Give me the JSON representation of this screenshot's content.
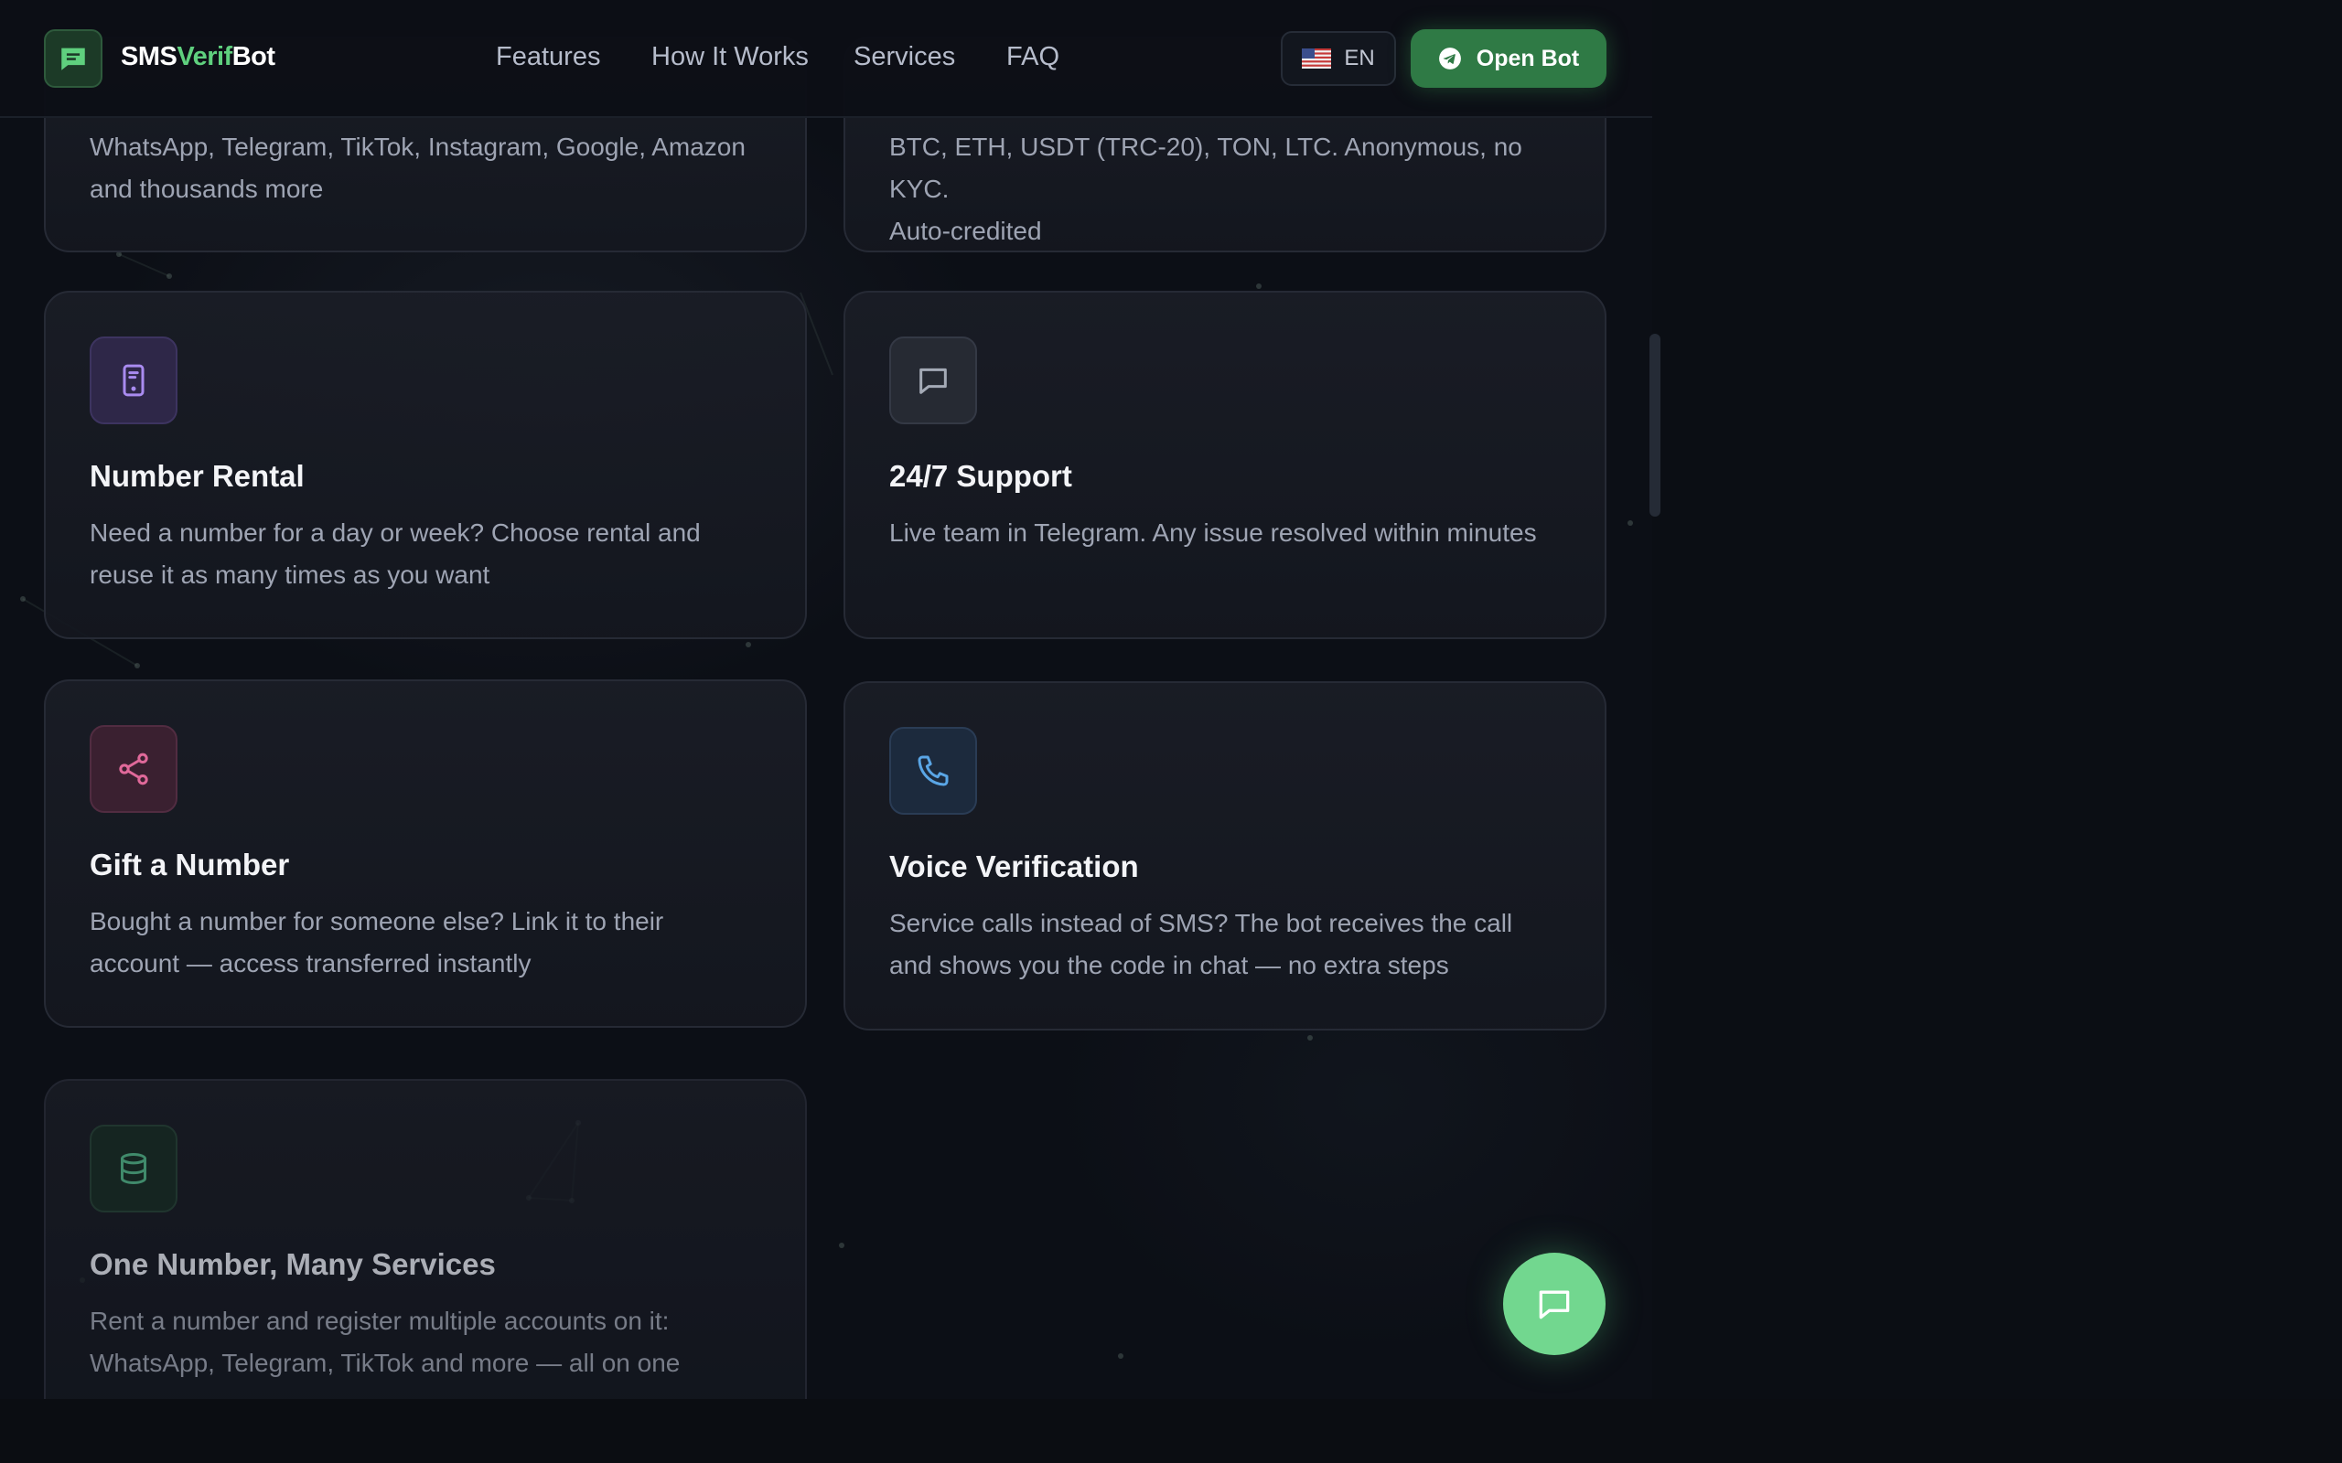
{
  "header": {
    "brand_prefix": "SMS",
    "brand_accent": "Verif",
    "brand_suffix": "Bot",
    "nav": [
      "Features",
      "How It Works",
      "Services",
      "FAQ"
    ],
    "language": "EN",
    "cta": "Open Bot"
  },
  "cards": [
    {
      "title": "",
      "desc_line1": "WhatsApp, Telegram, TikTok, Instagram, Google, Amazon",
      "desc_line2": "and thousands more"
    },
    {
      "title": "",
      "desc_line1": "BTC, ETH, USDT (TRC-20), TON, LTC. Anonymous, no KYC.",
      "desc_line2": "Auto-credited"
    },
    {
      "title": "Number Rental",
      "icon": "phone-device-icon",
      "desc_line1": "Need a number for a day or week? Choose rental and",
      "desc_line2": "reuse it as many times as you want"
    },
    {
      "title": "24/7 Support",
      "icon": "chat-bubble-icon",
      "desc_line1": "Live team in Telegram. Any issue resolved within minutes",
      "desc_line2": ""
    },
    {
      "title": "Gift a Number",
      "icon": "share-icon",
      "desc_line1": "Bought a number for someone else? Link it to their",
      "desc_line2": "account — access transferred instantly"
    },
    {
      "title": "Voice Verification",
      "icon": "phone-call-icon",
      "desc_line1": "Service calls instead of SMS? The bot receives the call",
      "desc_line2": "and shows you the code in chat — no extra steps"
    },
    {
      "title": "One Number, Many Services",
      "icon": "database-icon",
      "desc_line1": "Rent a number and register multiple accounts on it:",
      "desc_line2": "WhatsApp, Telegram, TikTok and more — all on one"
    }
  ],
  "colors": {
    "background": "#0c0f16",
    "brand_green": "#5fd07e",
    "cta_green": "#2f7a45",
    "fab_green": "#72d78f"
  }
}
